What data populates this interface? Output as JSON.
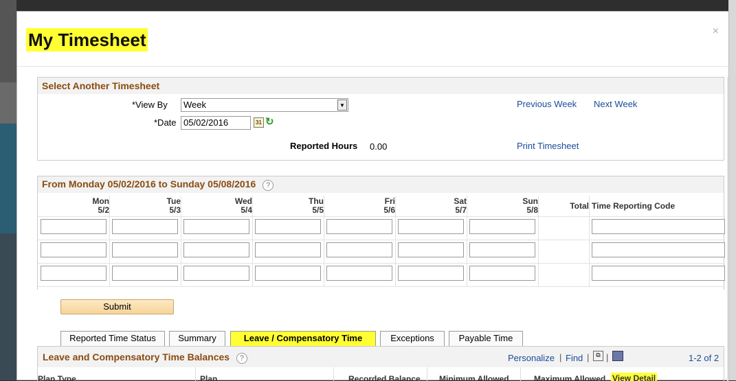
{
  "modal": {
    "title": "My Timesheet",
    "close_label": "×"
  },
  "select_section": {
    "heading": "Select Another Timesheet",
    "view_by_label": "*View By",
    "view_by_value": "Week",
    "date_label": "*Date",
    "date_value": "05/02/2016",
    "reported_hours_label": "Reported Hours",
    "reported_hours_value": "0.00",
    "previous_week": "Previous Week",
    "next_week": "Next Week",
    "print_timesheet": "Print Timesheet"
  },
  "grid": {
    "heading": "From Monday 05/02/2016 to Sunday 05/08/2016",
    "days": [
      {
        "day": "Mon",
        "date": "5/2"
      },
      {
        "day": "Tue",
        "date": "5/3"
      },
      {
        "day": "Wed",
        "date": "5/4"
      },
      {
        "day": "Thu",
        "date": "5/5"
      },
      {
        "day": "Fri",
        "date": "5/6"
      },
      {
        "day": "Sat",
        "date": "5/7"
      },
      {
        "day": "Sun",
        "date": "5/8"
      }
    ],
    "total_label": "Total",
    "trc_label": "Time Reporting Code"
  },
  "submit_label": "Submit",
  "tabs": [
    {
      "label": "Reported Time Status"
    },
    {
      "label": "Summary"
    },
    {
      "label": "Leave / Compensatory Time"
    },
    {
      "label": "Exceptions"
    },
    {
      "label": "Payable Time"
    }
  ],
  "balances": {
    "title": "Leave and Compensatory Time Balances",
    "personalize": "Personalize",
    "find": "Find",
    "pagination": "1-2 of 2",
    "columns": {
      "plan_type": "Plan Type",
      "plan": "Plan",
      "recorded_balance": "Recorded Balance",
      "minimum_allowed": "Minimum Allowed",
      "maximum_allowed": "Maximum Allowed",
      "view_detail": "View Detail"
    }
  },
  "help_glyph": "?",
  "colors": {
    "highlight": "#ffff33",
    "section_heading": "#8a4b0f",
    "link": "#1a4a99"
  }
}
